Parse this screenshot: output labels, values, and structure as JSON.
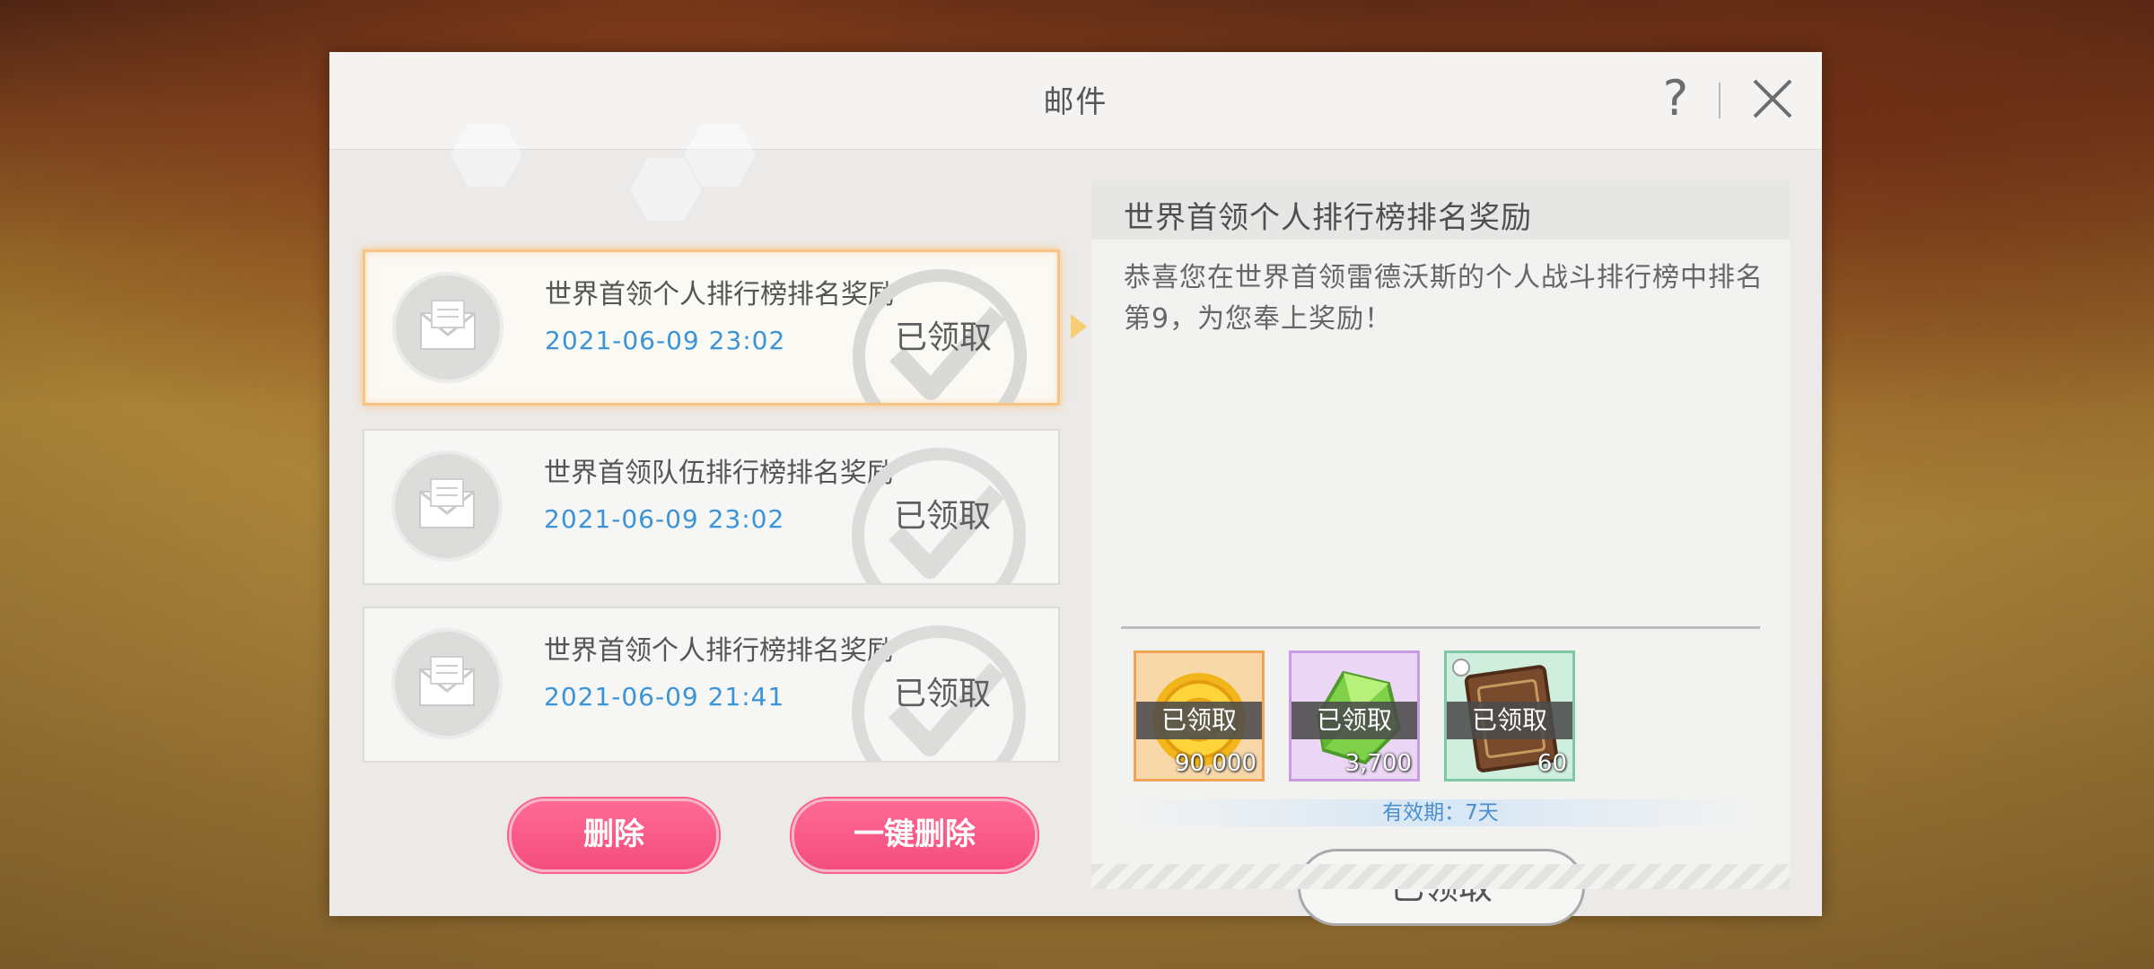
{
  "dialog": {
    "title": "邮件",
    "help_glyph": "?",
    "help_icon": "help-icon",
    "close_icon": "close-icon"
  },
  "mail_list": [
    {
      "title": "世界首领个人排行榜排名奖励",
      "date": "2021-06-09 23:02",
      "status": "已领取",
      "selected": true
    },
    {
      "title": "世界首领队伍排行榜排名奖励",
      "date": "2021-06-09 23:02",
      "status": "已领取",
      "selected": false
    },
    {
      "title": "世界首领个人排行榜排名奖励",
      "date": "2021-06-09 21:41",
      "status": "已领取",
      "selected": false
    }
  ],
  "buttons": {
    "delete": "删除",
    "delete_all": "一键删除"
  },
  "detail": {
    "title": "世界首领个人排行榜排名奖励",
    "body": "恭喜您在世界首领雷德沃斯的个人战斗排行榜中排名第9，为您奉上奖励！",
    "rewards": [
      {
        "icon": "gold-coin-icon",
        "claimed_label": "已领取",
        "quantity": "90,000",
        "frame_color": "#f0a45a"
      },
      {
        "icon": "green-crystal-icon",
        "claimed_label": "已领取",
        "quantity": "3,700",
        "frame_color": "#c99be0"
      },
      {
        "icon": "book-icon",
        "claimed_label": "已领取",
        "quantity": "60",
        "frame_color": "#7fc9a6"
      }
    ],
    "validity": "有效期：7天",
    "claim_button": "已领取"
  },
  "colors": {
    "date_blue": "#3b93d8",
    "pink_button": "#f44d7d",
    "selected_border": "#f7c485"
  }
}
